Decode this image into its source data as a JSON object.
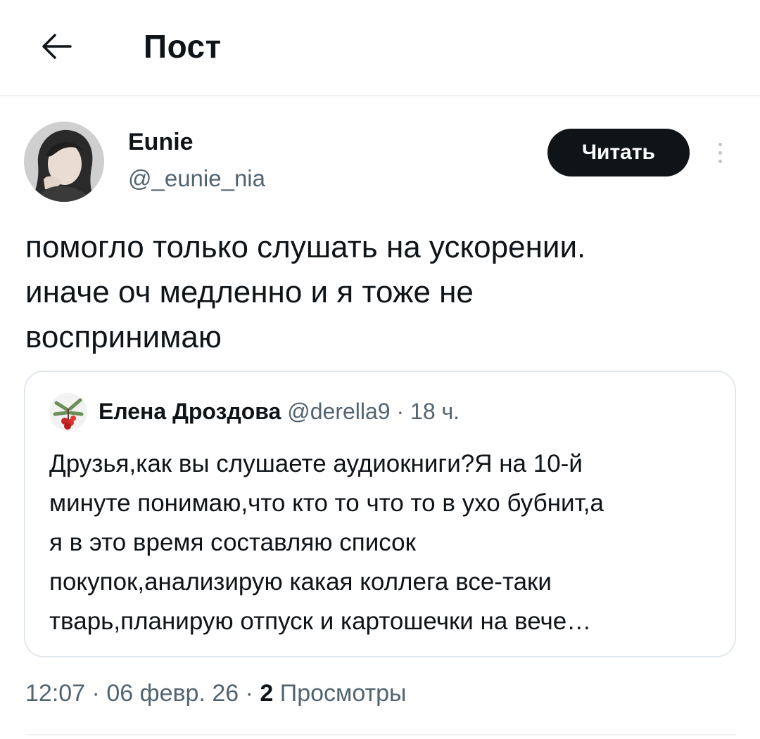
{
  "header": {
    "back_icon": "arrow-left-icon",
    "title": "Пост"
  },
  "author": {
    "name": "Eunie",
    "handle": "@_eunie_nia",
    "avatar_icon": "user-avatar"
  },
  "follow_button": {
    "label": "Читать"
  },
  "more_icon": "more-vertical-icon",
  "post": {
    "text": "помогло только слушать на ускорении.\nиначе оч медленно и я тоже не\nвоспринимаю"
  },
  "quoted_post": {
    "author_name": "Елена Дроздова",
    "author_handle": "@derella9",
    "separator": "·",
    "time": "18 ч.",
    "avatar_icon": "rowan-berries-avatar",
    "text": "Друзья,как вы слушаете аудиокниги?Я на 10-й\nминуте понимаю,что кто то что то в ухо бубнит,а\nя в это время составляю список\nпокупок,анализирую какая коллега все-таки\nтварь,планирую отпуск и картошечки на вече…"
  },
  "meta": {
    "time": "12:07",
    "separator": "·",
    "date": "06 февр. 26",
    "views_count": "2",
    "views_label": "Просмотры"
  },
  "colors": {
    "text_primary": "#0f1419",
    "text_secondary": "#536471",
    "border": "#e1e8ed",
    "button_bg": "#0f1419",
    "button_text": "#ffffff"
  }
}
